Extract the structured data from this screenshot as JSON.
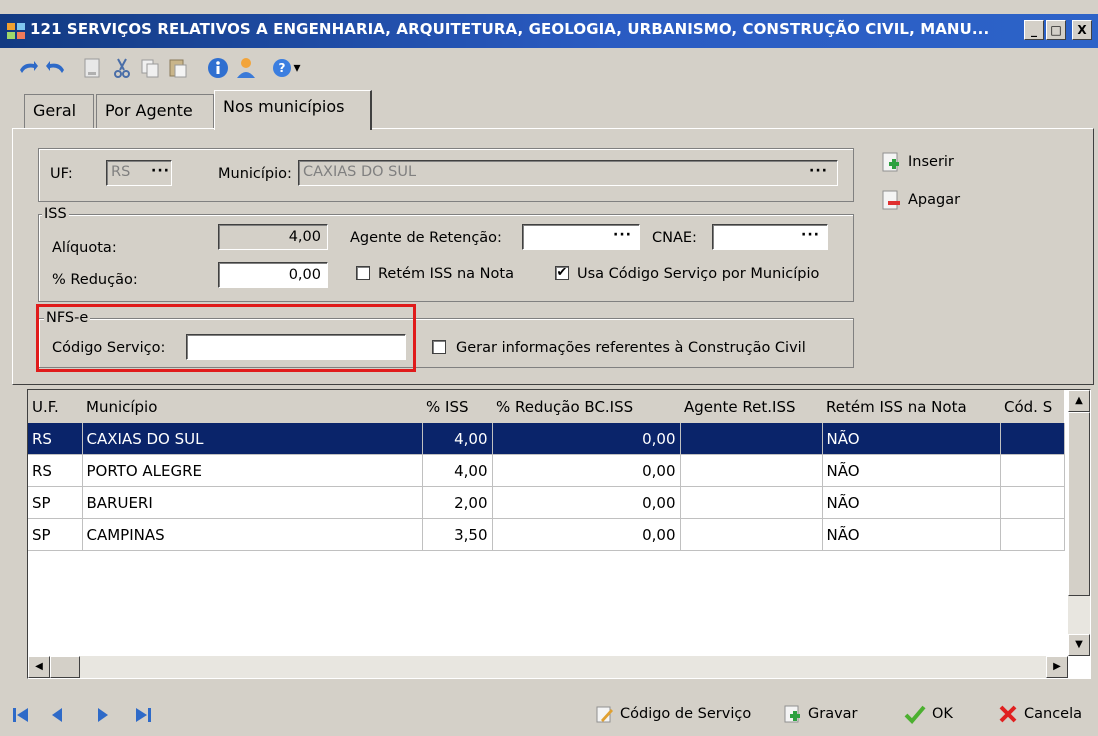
{
  "window": {
    "title": "121 SERVIÇOS RELATIVOS A ENGENHARIA, ARQUITETURA, GEOLOGIA, URBANISMO, CONSTRUÇÃO CIVIL, MANU...",
    "controls": [
      "_",
      "□",
      "X"
    ]
  },
  "toolbar": {
    "icons": [
      "undo-icon",
      "redo-icon",
      "new-document-icon",
      "cut-icon",
      "copy-icon",
      "paste-icon",
      "info-icon",
      "user-icon",
      "help-icon"
    ],
    "help_dropdown": "▾"
  },
  "tabs": [
    {
      "label": "Geral",
      "active": false
    },
    {
      "label": "Por Agente",
      "active": false
    },
    {
      "label": "Nos municípios",
      "active": true
    }
  ],
  "location": {
    "uf_label": "UF:",
    "uf_value": "RS",
    "municipio_label": "Município:",
    "municipio_value": "CAXIAS DO SUL",
    "lookup_dots": "···"
  },
  "actions": {
    "inserir": "Inserir",
    "apagar": "Apagar"
  },
  "iss": {
    "group_title": "ISS",
    "aliquota_label": "Alíquota:",
    "aliquota_value": "4,00",
    "reducao_label": "% Redução:",
    "reducao_value": "0,00",
    "agente_label": "Agente de Retenção:",
    "agente_value": "",
    "cnae_label": "CNAE:",
    "cnae_value": "",
    "retem_label": "Retém ISS na Nota",
    "retem_checked": false,
    "usa_codigo_label": "Usa Código Serviço por Município",
    "usa_codigo_checked": true
  },
  "nfse": {
    "group_title": "NFS-e",
    "codigo_label": "Código Serviço:",
    "codigo_value": "",
    "construcao_label": "Gerar informações referentes à Construção Civil",
    "construcao_checked": false
  },
  "grid": {
    "columns": [
      "U.F.",
      "Município",
      "% ISS",
      "% Redução BC.ISS",
      "Agente Ret.ISS",
      "Retém ISS na Nota",
      "Cód. S"
    ],
    "rows": [
      {
        "uf": "RS",
        "municipio": "CAXIAS DO SUL",
        "iss": "4,00",
        "reducao": "0,00",
        "agente": "",
        "retem": "NÃO",
        "cod": ""
      },
      {
        "uf": "RS",
        "municipio": "PORTO ALEGRE",
        "iss": "4,00",
        "reducao": "0,00",
        "agente": "",
        "retem": "NÃO",
        "cod": ""
      },
      {
        "uf": "SP",
        "municipio": "BARUERI",
        "iss": "2,00",
        "reducao": "0,00",
        "agente": "",
        "retem": "NÃO",
        "cod": ""
      },
      {
        "uf": "SP",
        "municipio": "CAMPINAS",
        "iss": "3,50",
        "reducao": "0,00",
        "agente": "",
        "retem": "NÃO",
        "cod": ""
      }
    ],
    "selected_row": 0
  },
  "footer": {
    "codigo_servico": "Código de Serviço",
    "gravar": "Gravar",
    "ok": "OK",
    "cancela": "Cancela"
  },
  "colors": {
    "titlebar": "#1f4ea8",
    "selection": "#0a246a",
    "highlight_box": "#e01b1b",
    "face": "#d4d0c8"
  }
}
